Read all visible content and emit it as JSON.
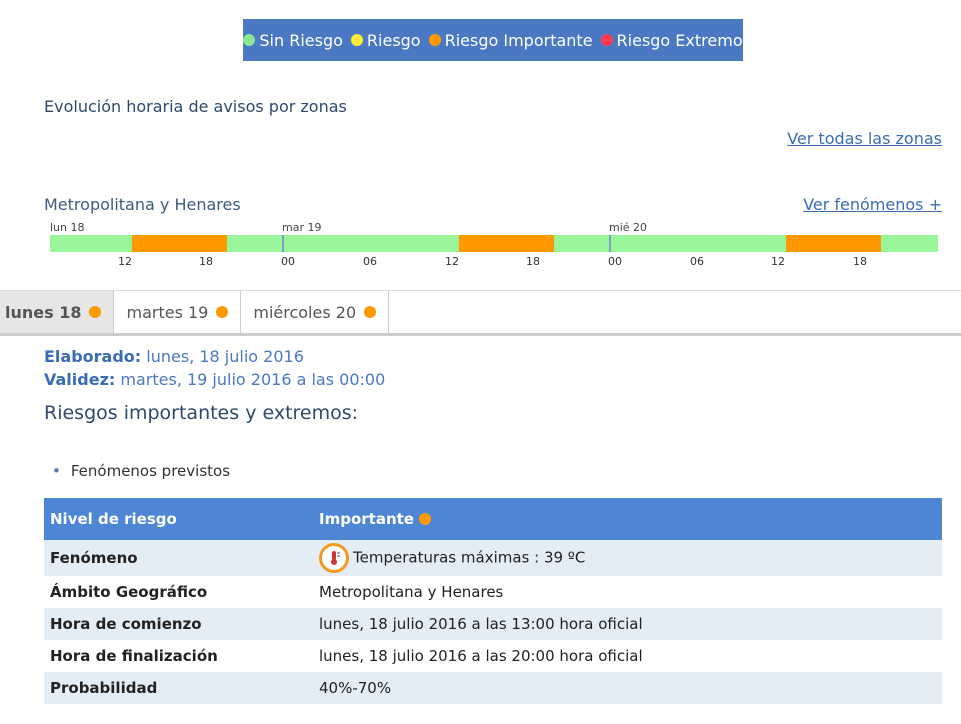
{
  "legend": [
    {
      "label": "Sin Riesgo",
      "color": "#8de88d"
    },
    {
      "label": "Riesgo",
      "color": "#ffee33"
    },
    {
      "label": "Riesgo Importante",
      "color": "#ff9900"
    },
    {
      "label": "Riesgo Extremo",
      "color": "#ff3b4e"
    }
  ],
  "section_title": "Evolución horaria de avisos por zonas",
  "link_all_zones": "Ver todas las zonas",
  "zone": {
    "name": "Metropolitana y Henares",
    "link_phenomena": "Ver fenómenos +"
  },
  "timeline": {
    "days": [
      "lun 18",
      "mar 19",
      "mié 20"
    ],
    "hours": [
      "12",
      "18",
      "00",
      "06",
      "12",
      "18",
      "00",
      "06",
      "12",
      "18"
    ],
    "levels": [
      "sin",
      "importante",
      "sin",
      "importante",
      "sin",
      "importante",
      "sin"
    ]
  },
  "tabs": [
    {
      "label": "lunes 18",
      "level_color": "#ff9900"
    },
    {
      "label": "martes 19",
      "level_color": "#ff9900"
    },
    {
      "label": "miércoles 20",
      "level_color": "#ff9900"
    }
  ],
  "meta": {
    "elaborado_label": "Elaborado:",
    "elaborado_value": "lunes, 18 julio 2016",
    "validez_label": "Validez:",
    "validez_value": "martes, 19 julio 2016 a las 00:00"
  },
  "risks_heading": "Riesgos importantes y extremos:",
  "bullet": "Fenómenos previstos",
  "table": {
    "header": {
      "key": "Nivel de riesgo",
      "value": "Importante"
    },
    "rows": [
      {
        "key": "Fenómeno",
        "value": "Temperaturas máximas : 39 ºC",
        "icon": "thermometer-icon"
      },
      {
        "key": "Ámbito Geográfico",
        "value": "Metropolitana y Henares"
      },
      {
        "key": "Hora de comienzo",
        "value": "lunes, 18 julio 2016 a las 13:00 hora oficial"
      },
      {
        "key": "Hora de finalización",
        "value": "lunes, 18 julio 2016 a las 20:00 hora oficial"
      },
      {
        "key": "Probabilidad",
        "value": "40%-70%"
      }
    ]
  }
}
